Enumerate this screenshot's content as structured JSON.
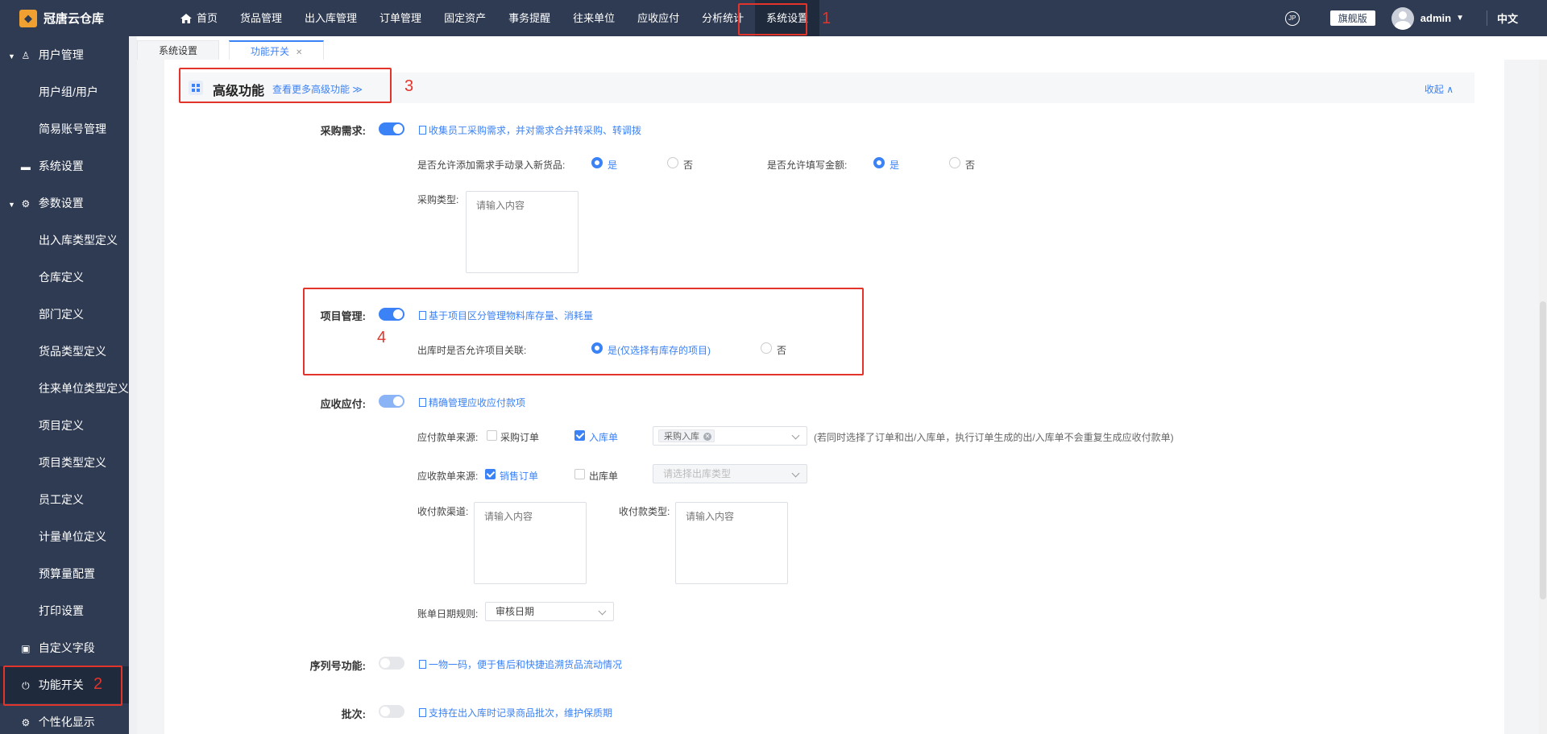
{
  "app": {
    "name": "冠唐云仓库"
  },
  "nav": {
    "items": [
      "首页",
      "货品管理",
      "出入库管理",
      "订单管理",
      "固定资产",
      "事务提醒",
      "往来单位",
      "应收应付",
      "分析统计",
      "系统设置"
    ],
    "active": "系统设置"
  },
  "topright": {
    "edition": "旗舰版",
    "user": "admin",
    "lang": "中文",
    "icon_label": "JP"
  },
  "sidebar": {
    "user_mgmt": "用户管理",
    "user_group": "用户组/用户",
    "simple_account": "简易账号管理",
    "system_settings": "系统设置",
    "param_settings": "参数设置",
    "io_type": "出入库类型定义",
    "warehouse": "仓库定义",
    "department": "部门定义",
    "goods_type": "货品类型定义",
    "partner_type": "往来单位类型定义",
    "project": "项目定义",
    "project_type": "项目类型定义",
    "employee": "员工定义",
    "unit": "计量单位定义",
    "budget": "预算量配置",
    "print": "打印设置",
    "custom_fields": "自定义字段",
    "feature_switch": "功能开关",
    "personal_display": "个性化显示"
  },
  "tabs": [
    {
      "label": "系统设置"
    },
    {
      "label": "功能开关"
    }
  ],
  "section": {
    "title": "高级功能",
    "link": "查看更多高级功能 ≫",
    "collapse": "收起 ∧"
  },
  "purchase": {
    "label": "采购需求:",
    "desc": "收集员工采购需求，并对需求合并转采购、转调拨",
    "allow_manual": "是否允许添加需求手动录入新货品:",
    "allow_amount": "是否允许填写金额:",
    "yes": "是",
    "no": "否",
    "type_label": "采购类型:",
    "type_placeholder": "请输入内容"
  },
  "project": {
    "label": "项目管理:",
    "desc": "基于项目区分管理物料库存量、消耗量",
    "allow_link": "出库时是否允许项目关联:",
    "yes": "是(仅选择有库存的项目)",
    "no": "否"
  },
  "ar": {
    "label": "应收应付:",
    "desc": "精确管理应收应付款项",
    "payable_source": "应付款单来源:",
    "purchase_order": "采购订单",
    "stock_in": "入库单",
    "tag": "采购入库",
    "hint": "(若同时选择了订单和出/入库单，执行订单生成的出/入库单不会重复生成应收付款单)",
    "receivable_source": "应收款单来源:",
    "sales_order": "销售订单",
    "stock_out": "出库单",
    "out_type_placeholder": "请选择出库类型",
    "channel_label": "收付款渠道:",
    "channel_placeholder": "请输入内容",
    "pay_type_label": "收付款类型:",
    "pay_type_placeholder": "请输入内容",
    "date_rule_label": "账单日期规则:",
    "date_rule_value": "审核日期"
  },
  "serial": {
    "label": "序列号功能:",
    "desc": "一物一码，便于售后和快捷追溯货品流动情况"
  },
  "batch": {
    "label": "批次:",
    "desc": "支持在出入库时记录商品批次，维护保质期"
  },
  "callouts": {
    "n1": "1",
    "n2": "2",
    "n3": "3",
    "n4": "4"
  }
}
